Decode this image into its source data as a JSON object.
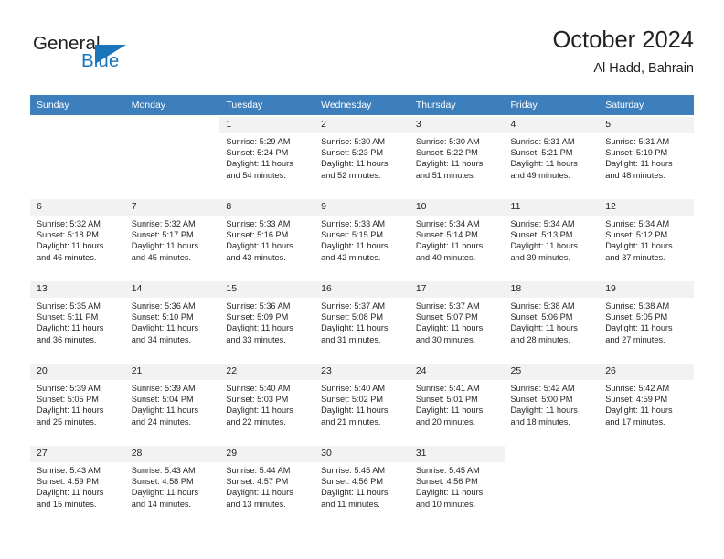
{
  "brand": {
    "word1": "General",
    "word2": "Blue",
    "accent_color": "#1b75bb",
    "logo_icon": "triangle-icon"
  },
  "header": {
    "title": "October 2024",
    "location": "Al Hadd, Bahrain"
  },
  "calendar": {
    "header_bg": "#3d7ebd",
    "shaded_bg": "#f2f2f2",
    "weekday_headers": [
      "Sunday",
      "Monday",
      "Tuesday",
      "Wednesday",
      "Thursday",
      "Friday",
      "Saturday"
    ],
    "weeks": [
      [
        {
          "day": "",
          "lines": []
        },
        {
          "day": "",
          "lines": []
        },
        {
          "day": "1",
          "lines": [
            "Sunrise: 5:29 AM",
            "Sunset: 5:24 PM",
            "Daylight: 11 hours",
            "and 54 minutes."
          ]
        },
        {
          "day": "2",
          "lines": [
            "Sunrise: 5:30 AM",
            "Sunset: 5:23 PM",
            "Daylight: 11 hours",
            "and 52 minutes."
          ]
        },
        {
          "day": "3",
          "lines": [
            "Sunrise: 5:30 AM",
            "Sunset: 5:22 PM",
            "Daylight: 11 hours",
            "and 51 minutes."
          ]
        },
        {
          "day": "4",
          "lines": [
            "Sunrise: 5:31 AM",
            "Sunset: 5:21 PM",
            "Daylight: 11 hours",
            "and 49 minutes."
          ]
        },
        {
          "day": "5",
          "lines": [
            "Sunrise: 5:31 AM",
            "Sunset: 5:19 PM",
            "Daylight: 11 hours",
            "and 48 minutes."
          ]
        }
      ],
      [
        {
          "day": "6",
          "lines": [
            "Sunrise: 5:32 AM",
            "Sunset: 5:18 PM",
            "Daylight: 11 hours",
            "and 46 minutes."
          ]
        },
        {
          "day": "7",
          "lines": [
            "Sunrise: 5:32 AM",
            "Sunset: 5:17 PM",
            "Daylight: 11 hours",
            "and 45 minutes."
          ]
        },
        {
          "day": "8",
          "lines": [
            "Sunrise: 5:33 AM",
            "Sunset: 5:16 PM",
            "Daylight: 11 hours",
            "and 43 minutes."
          ]
        },
        {
          "day": "9",
          "lines": [
            "Sunrise: 5:33 AM",
            "Sunset: 5:15 PM",
            "Daylight: 11 hours",
            "and 42 minutes."
          ]
        },
        {
          "day": "10",
          "lines": [
            "Sunrise: 5:34 AM",
            "Sunset: 5:14 PM",
            "Daylight: 11 hours",
            "and 40 minutes."
          ]
        },
        {
          "day": "11",
          "lines": [
            "Sunrise: 5:34 AM",
            "Sunset: 5:13 PM",
            "Daylight: 11 hours",
            "and 39 minutes."
          ]
        },
        {
          "day": "12",
          "lines": [
            "Sunrise: 5:34 AM",
            "Sunset: 5:12 PM",
            "Daylight: 11 hours",
            "and 37 minutes."
          ]
        }
      ],
      [
        {
          "day": "13",
          "lines": [
            "Sunrise: 5:35 AM",
            "Sunset: 5:11 PM",
            "Daylight: 11 hours",
            "and 36 minutes."
          ]
        },
        {
          "day": "14",
          "lines": [
            "Sunrise: 5:36 AM",
            "Sunset: 5:10 PM",
            "Daylight: 11 hours",
            "and 34 minutes."
          ]
        },
        {
          "day": "15",
          "lines": [
            "Sunrise: 5:36 AM",
            "Sunset: 5:09 PM",
            "Daylight: 11 hours",
            "and 33 minutes."
          ]
        },
        {
          "day": "16",
          "lines": [
            "Sunrise: 5:37 AM",
            "Sunset: 5:08 PM",
            "Daylight: 11 hours",
            "and 31 minutes."
          ]
        },
        {
          "day": "17",
          "lines": [
            "Sunrise: 5:37 AM",
            "Sunset: 5:07 PM",
            "Daylight: 11 hours",
            "and 30 minutes."
          ]
        },
        {
          "day": "18",
          "lines": [
            "Sunrise: 5:38 AM",
            "Sunset: 5:06 PM",
            "Daylight: 11 hours",
            "and 28 minutes."
          ]
        },
        {
          "day": "19",
          "lines": [
            "Sunrise: 5:38 AM",
            "Sunset: 5:05 PM",
            "Daylight: 11 hours",
            "and 27 minutes."
          ]
        }
      ],
      [
        {
          "day": "20",
          "lines": [
            "Sunrise: 5:39 AM",
            "Sunset: 5:05 PM",
            "Daylight: 11 hours",
            "and 25 minutes."
          ]
        },
        {
          "day": "21",
          "lines": [
            "Sunrise: 5:39 AM",
            "Sunset: 5:04 PM",
            "Daylight: 11 hours",
            "and 24 minutes."
          ]
        },
        {
          "day": "22",
          "lines": [
            "Sunrise: 5:40 AM",
            "Sunset: 5:03 PM",
            "Daylight: 11 hours",
            "and 22 minutes."
          ]
        },
        {
          "day": "23",
          "lines": [
            "Sunrise: 5:40 AM",
            "Sunset: 5:02 PM",
            "Daylight: 11 hours",
            "and 21 minutes."
          ]
        },
        {
          "day": "24",
          "lines": [
            "Sunrise: 5:41 AM",
            "Sunset: 5:01 PM",
            "Daylight: 11 hours",
            "and 20 minutes."
          ]
        },
        {
          "day": "25",
          "lines": [
            "Sunrise: 5:42 AM",
            "Sunset: 5:00 PM",
            "Daylight: 11 hours",
            "and 18 minutes."
          ]
        },
        {
          "day": "26",
          "lines": [
            "Sunrise: 5:42 AM",
            "Sunset: 4:59 PM",
            "Daylight: 11 hours",
            "and 17 minutes."
          ]
        }
      ],
      [
        {
          "day": "27",
          "lines": [
            "Sunrise: 5:43 AM",
            "Sunset: 4:59 PM",
            "Daylight: 11 hours",
            "and 15 minutes."
          ]
        },
        {
          "day": "28",
          "lines": [
            "Sunrise: 5:43 AM",
            "Sunset: 4:58 PM",
            "Daylight: 11 hours",
            "and 14 minutes."
          ]
        },
        {
          "day": "29",
          "lines": [
            "Sunrise: 5:44 AM",
            "Sunset: 4:57 PM",
            "Daylight: 11 hours",
            "and 13 minutes."
          ]
        },
        {
          "day": "30",
          "lines": [
            "Sunrise: 5:45 AM",
            "Sunset: 4:56 PM",
            "Daylight: 11 hours",
            "and 11 minutes."
          ]
        },
        {
          "day": "31",
          "lines": [
            "Sunrise: 5:45 AM",
            "Sunset: 4:56 PM",
            "Daylight: 11 hours",
            "and 10 minutes."
          ]
        },
        {
          "day": "",
          "lines": []
        },
        {
          "day": "",
          "lines": []
        }
      ]
    ]
  }
}
